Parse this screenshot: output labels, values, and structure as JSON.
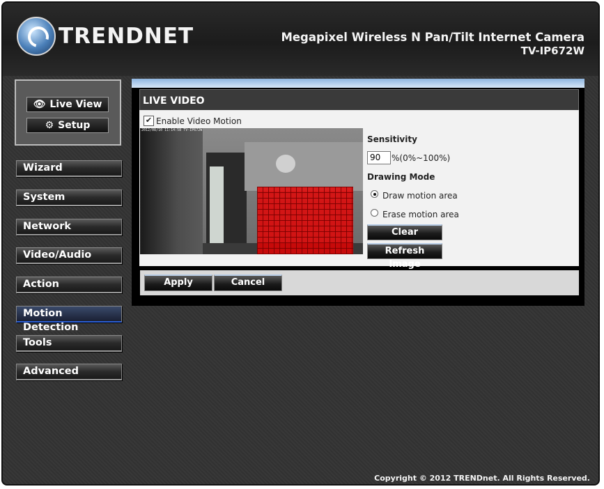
{
  "header": {
    "brand": "TRENDNET",
    "product_title": "Megapixel Wireless N Pan/Tilt Internet Camera",
    "model": "TV-IP672W"
  },
  "sidebar": {
    "top_buttons": [
      {
        "label": "Live View",
        "icon": "eye-icon"
      },
      {
        "label": "Setup",
        "icon": "gears-icon"
      }
    ],
    "items": [
      {
        "label": "Wizard"
      },
      {
        "label": "System"
      },
      {
        "label": "Network"
      },
      {
        "label": "Video/Audio"
      },
      {
        "label": "Action"
      },
      {
        "label": "Motion Detection",
        "active": true
      },
      {
        "label": "Tools"
      },
      {
        "label": "Advanced"
      }
    ]
  },
  "main": {
    "section_title": "LIVE VIDEO",
    "enable_motion": {
      "label": "Enable Video Motion",
      "checked": true
    },
    "video_timestamp": "2012/08/10 11:14:58 TV-IP672W",
    "sensitivity": {
      "label": "Sensitivity",
      "value": "90",
      "range": "%(0%~100%)"
    },
    "drawing_mode": {
      "label": "Drawing Mode",
      "options": [
        {
          "label": "Draw motion area",
          "selected": true
        },
        {
          "label": "Erase motion area",
          "selected": false
        }
      ]
    },
    "clear_label": "Clear",
    "refresh_label": "Refresh Image",
    "apply_label": "Apply",
    "cancel_label": "Cancel"
  },
  "footer": {
    "copyright": "Copyright © 2012 TRENDnet. All Rights Reserved."
  },
  "colors": {
    "accent": "#2b5fd6",
    "motion_area": "#e60000",
    "topbar": "#8fb6e0"
  }
}
